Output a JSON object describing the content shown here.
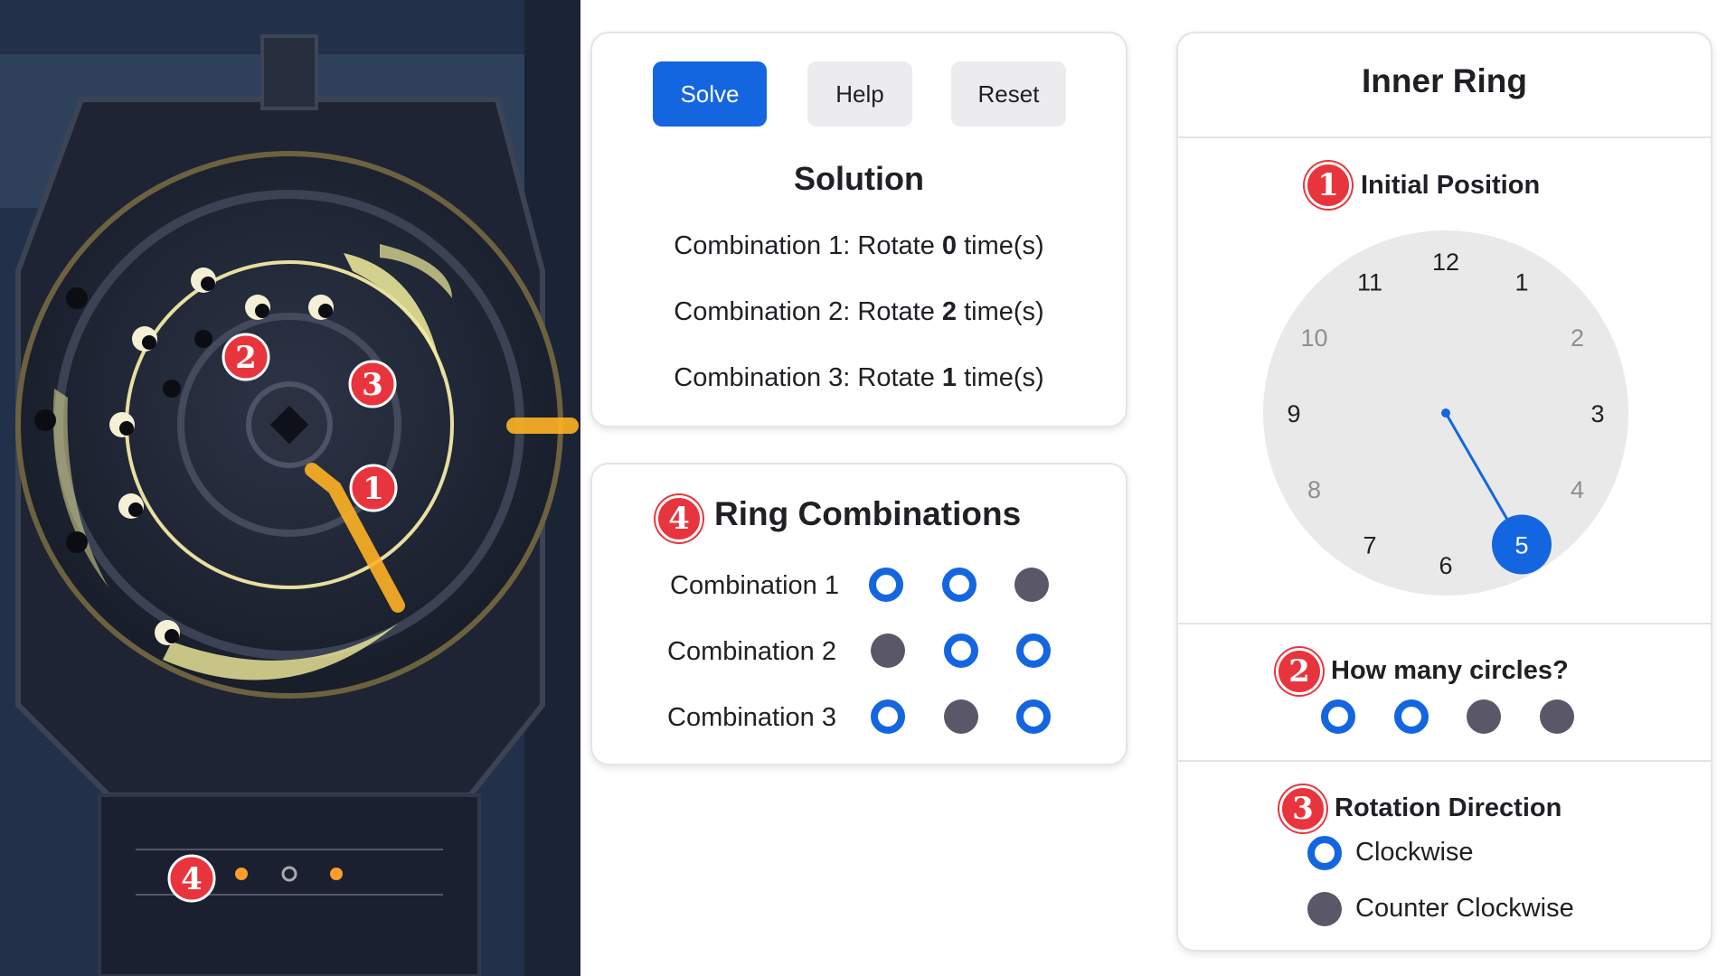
{
  "toolbar": {
    "solve_label": "Solve",
    "help_label": "Help",
    "reset_label": "Reset"
  },
  "solution": {
    "title": "Solution",
    "lines": [
      {
        "prefix": "Combination 1: Rotate ",
        "count": "0",
        "suffix": " time(s)"
      },
      {
        "prefix": "Combination 2: Rotate ",
        "count": "2",
        "suffix": " time(s)"
      },
      {
        "prefix": "Combination 3: Rotate ",
        "count": "1",
        "suffix": " time(s)"
      }
    ]
  },
  "combinations": {
    "badge": "4",
    "title": "Ring Combinations",
    "rows": [
      {
        "label": "Combination 1",
        "states": [
          true,
          true,
          false
        ]
      },
      {
        "label": "Combination 2",
        "states": [
          false,
          true,
          true
        ]
      },
      {
        "label": "Combination 3",
        "states": [
          true,
          false,
          true
        ]
      }
    ]
  },
  "inner_ring": {
    "title": "Inner Ring",
    "initial_position": {
      "badge": "1",
      "label": "Initial Position",
      "clock_numbers": [
        "12",
        "1",
        "2",
        "3",
        "4",
        "5",
        "6",
        "7",
        "8",
        "9",
        "10",
        "11"
      ],
      "selected": "5"
    },
    "circles": {
      "badge": "2",
      "label": "How many circles?",
      "states": [
        true,
        true,
        false,
        false
      ]
    },
    "direction": {
      "badge": "3",
      "label": "Rotation Direction",
      "options": [
        {
          "label": "Clockwise",
          "selected": true
        },
        {
          "label": "Counter Clockwise",
          "selected": false
        }
      ]
    }
  },
  "game_markers": [
    "1",
    "2",
    "3",
    "4"
  ],
  "colors": {
    "accent": "#1466e0",
    "badge": "#e8353d",
    "inactive": "#5a5768",
    "glow": "#f2ee9c"
  }
}
